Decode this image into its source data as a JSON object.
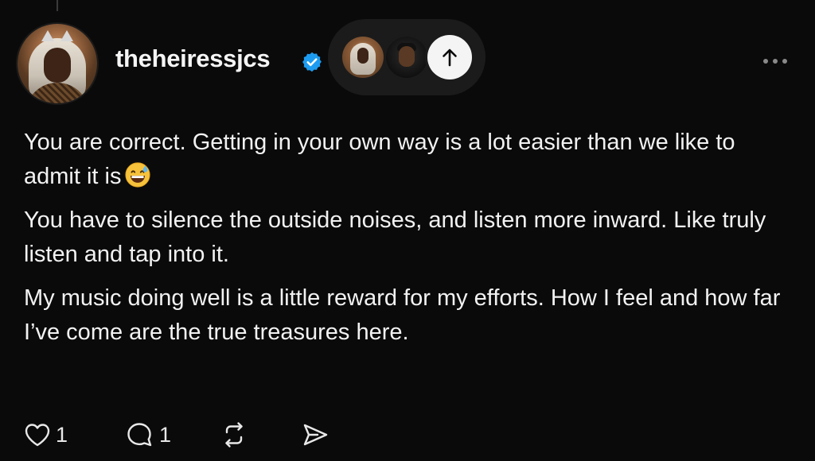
{
  "post": {
    "username": "theheiressjcs",
    "verified": true,
    "accent_color": "#1d9bf0",
    "paragraphs": [
      "You are correct. Getting in your own way is a lot easier than we like to admit it is",
      "You have to silence the outside noises, and listen more inward. Like truly listen and tap into it.",
      "My music doing well is a little reward for my efforts. How I feel and how far I’ve come are the true treasures here."
    ],
    "emoji_after_paragraph_1": "grinning-face-with-sweat"
  },
  "reply_pill": {
    "icon": "arrow-up-icon"
  },
  "actions": {
    "like_count": "1",
    "reply_count": "1",
    "like_icon": "heart-icon",
    "reply_icon": "speech-bubble-icon",
    "repost_icon": "repost-icon",
    "share_icon": "send-icon"
  }
}
